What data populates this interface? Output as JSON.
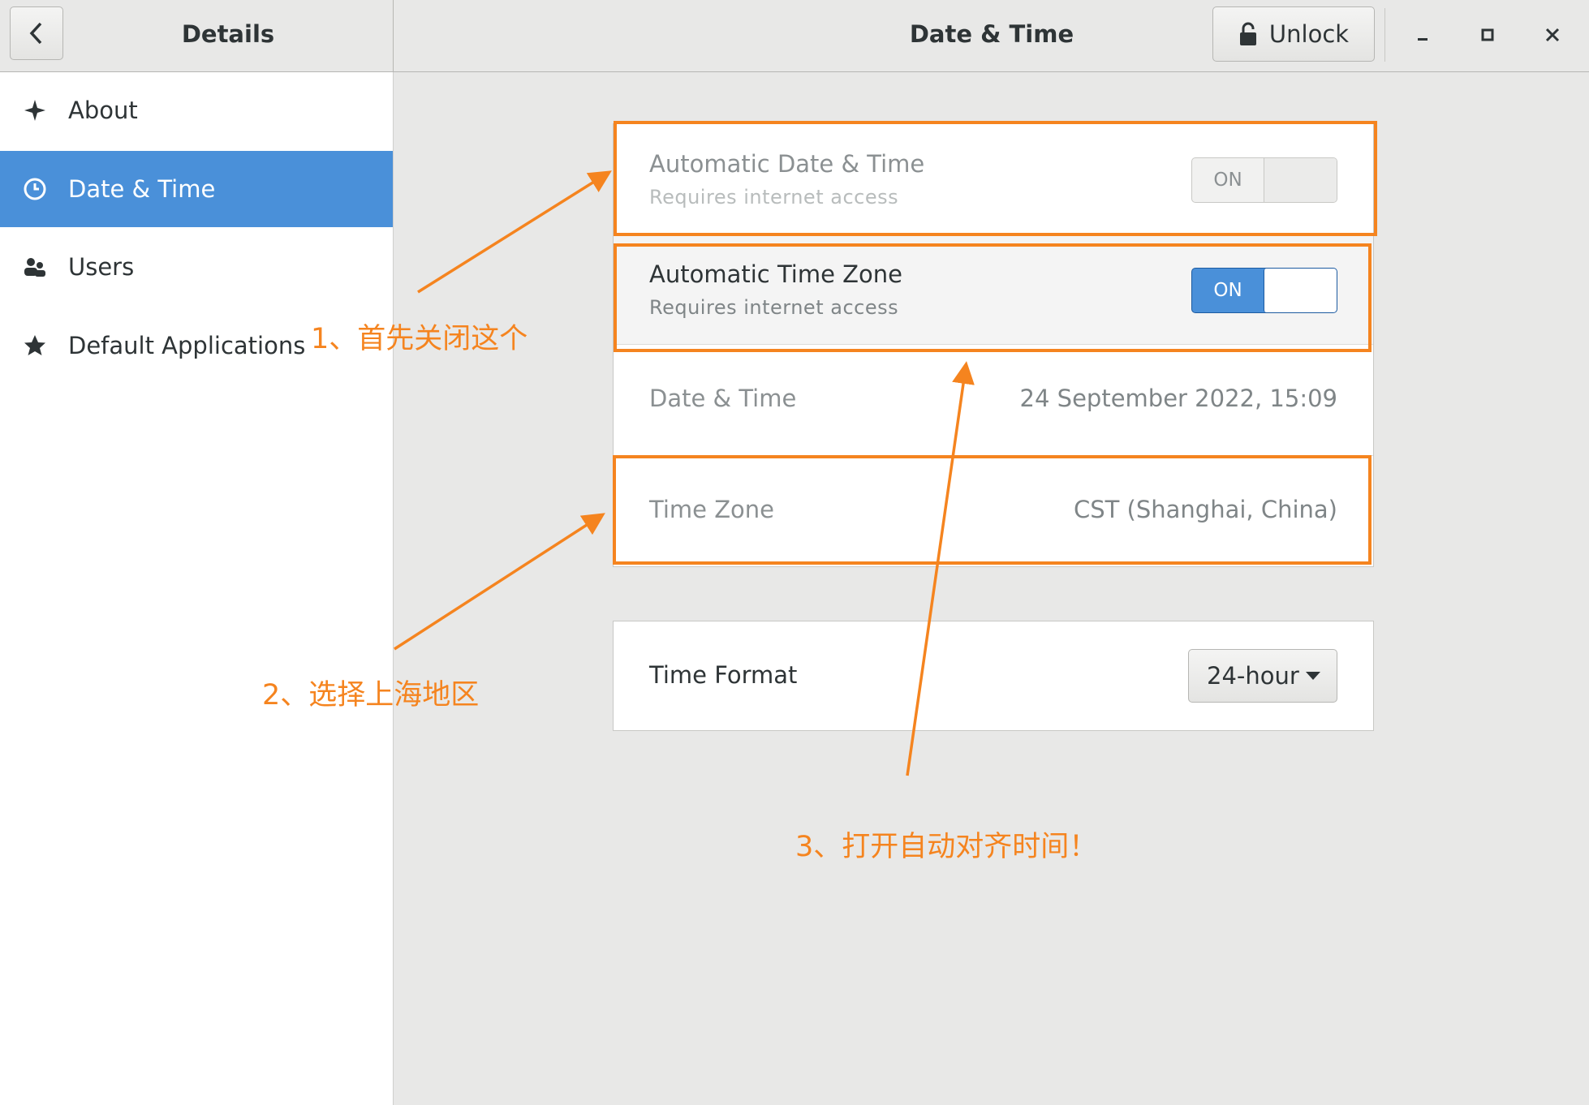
{
  "header": {
    "sidebar_title": "Details",
    "page_title": "Date & Time",
    "unlock_label": "Unlock"
  },
  "sidebar": {
    "items": [
      {
        "label": "About",
        "icon": "sparkle-icon",
        "active": false
      },
      {
        "label": "Date & Time",
        "icon": "clock-icon",
        "active": true
      },
      {
        "label": "Users",
        "icon": "users-icon",
        "active": false
      },
      {
        "label": "Default Applications",
        "icon": "star-icon",
        "active": false
      }
    ]
  },
  "settings": {
    "auto_datetime": {
      "title": "Automatic Date & Time",
      "subtitle": "Requires internet access",
      "toggle_label": "ON",
      "state": "on-disabled"
    },
    "auto_timezone": {
      "title": "Automatic Time Zone",
      "subtitle": "Requires internet access",
      "toggle_label": "ON",
      "state": "on"
    },
    "datetime": {
      "title": "Date & Time",
      "value": "24 September 2022, 15:09"
    },
    "timezone": {
      "title": "Time Zone",
      "value": "CST (Shanghai, China)"
    },
    "time_format": {
      "title": "Time Format",
      "value": "24-hour"
    }
  },
  "annotations": {
    "note1": "1、首先关闭这个",
    "note2": "2、选择上海地区",
    "note3": "3、打开自动对齐时间！"
  },
  "colors": {
    "accent": "#4a90d9",
    "annotation": "#f5841f"
  }
}
